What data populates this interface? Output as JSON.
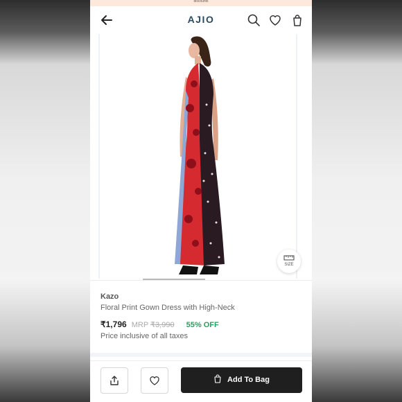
{
  "header": {
    "promo_text": "discounts",
    "logo": "AJIO",
    "icons": [
      "back-arrow-icon",
      "search-icon",
      "heart-icon",
      "bag-icon"
    ]
  },
  "gallery": {
    "size_label": "SIZE"
  },
  "product": {
    "brand": "Kazo",
    "title": "Floral Print Gown Dress with High-Neck",
    "price": "₹1,796",
    "mrp_label": "MRP",
    "mrp_value": "₹3,990",
    "discount": "55% OFF",
    "tax_note": "Price inclusive of all taxes"
  },
  "bottom_bar": {
    "add_to_bag_label": "Add To Bag"
  },
  "colors": {
    "logo": "#2b4b5c",
    "discount": "#27a060",
    "cta_bg": "#1f1f1f"
  }
}
